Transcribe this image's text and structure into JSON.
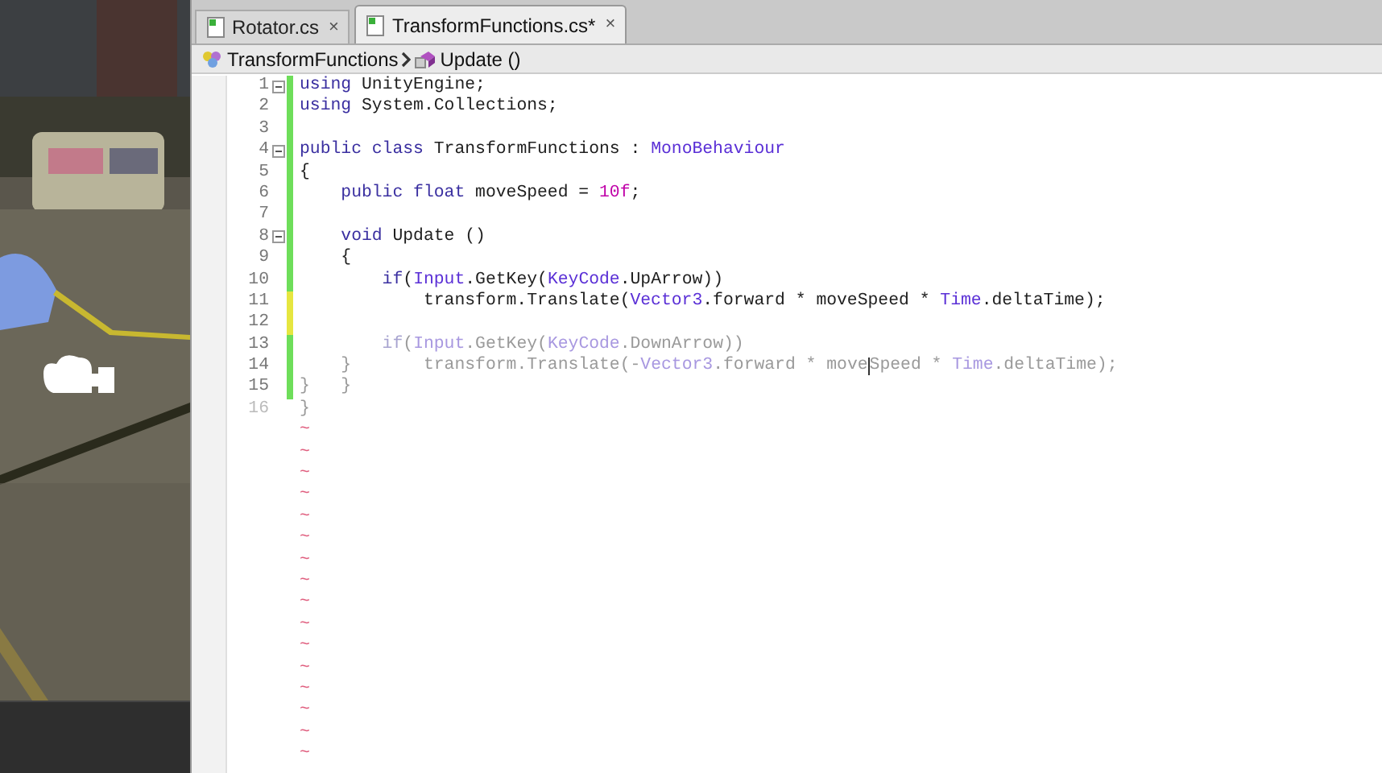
{
  "tabs": [
    {
      "label": "Rotator.cs",
      "close": "×",
      "selected": false
    },
    {
      "label": "TransformFunctions.cs*",
      "close": "×",
      "selected": true
    }
  ],
  "breadcrumb": [
    {
      "kind": "class",
      "label": "TransformFunctions"
    },
    {
      "kind": "method",
      "label": "Update ()"
    }
  ],
  "lines": [
    {
      "number": "1",
      "fold": true,
      "color": "#6ede5a",
      "tokens": [
        {
          "text": "using",
          "kind": "kw"
        },
        {
          "text": " UnityEngine;",
          "kind": "plain"
        }
      ]
    },
    {
      "number": "2",
      "fold": false,
      "color": "#6ede5a",
      "tokens": [
        {
          "text": "using",
          "kind": "kw"
        },
        {
          "text": " System.Collections;",
          "kind": "plain"
        }
      ]
    },
    {
      "number": "3",
      "fold": false,
      "color": "#6ede5a"
    },
    {
      "number": "4",
      "fold": true,
      "color": "#6ede5a",
      "tokens": [
        {
          "text": "public class",
          "kind": "kw"
        },
        {
          "text": " TransformFunctions : ",
          "kind": "plain"
        },
        {
          "text": "MonoBehaviour",
          "kind": "type"
        }
      ]
    },
    {
      "number": "5",
      "fold": false,
      "color": "#6ede5a",
      "tokens": [
        {
          "text": "{",
          "kind": "plain"
        }
      ]
    },
    {
      "number": "6",
      "fold": false,
      "color": "#6ede5a",
      "tokens": [
        {
          "text": "    public float",
          "kind": "kw"
        },
        {
          "text": " moveSpeed = ",
          "kind": "plain"
        },
        {
          "text": "10f",
          "kind": "num"
        },
        {
          "text": ";",
          "kind": "plain"
        }
      ]
    },
    {
      "number": "7",
      "fold": false,
      "color": "#6ede5a"
    },
    {
      "number": "8",
      "fold": true,
      "color": "#6ede5a",
      "tokens": [
        {
          "text": "    void",
          "kind": "kw"
        },
        {
          "text": " Update ()",
          "kind": "plain"
        }
      ]
    },
    {
      "number": "9",
      "fold": false,
      "color": "#6ede5a",
      "tokens": [
        {
          "text": "    {",
          "kind": "plain"
        }
      ]
    },
    {
      "number": "10",
      "fold": false,
      "color": "#6ede5a",
      "tokens": [
        {
          "text": "        if",
          "kind": "kw"
        },
        {
          "text": "(",
          "kind": "plain"
        },
        {
          "text": "Input",
          "kind": "type"
        },
        {
          "text": ".GetKey(",
          "kind": "plain"
        },
        {
          "text": "KeyCode",
          "kind": "type"
        },
        {
          "text": ".UpArrow))",
          "kind": "plain"
        }
      ]
    },
    {
      "number": "11",
      "fold": false,
      "color": "#e6e640",
      "tokens": [
        {
          "text": "            transform.Translate(",
          "kind": "plain"
        },
        {
          "text": "Vector3",
          "kind": "type"
        },
        {
          "text": ".forward * moveSpeed * ",
          "kind": "plain"
        },
        {
          "text": "Time",
          "kind": "type"
        },
        {
          "text": ".deltaTime);",
          "kind": "plain"
        }
      ]
    },
    {
      "number": "12",
      "fold": false,
      "color": "#e6e640"
    },
    {
      "number": "13",
      "fold": false,
      "color": "#6ede5a",
      "tokens": [
        {
          "text": "        if",
          "kind": "kw",
          "dim": true
        },
        {
          "text": "(",
          "kind": "plain",
          "dim": true
        },
        {
          "text": "Input",
          "kind": "type",
          "dim": true
        },
        {
          "text": ".GetKey(",
          "kind": "plain",
          "dim": true
        },
        {
          "text": "KeyCode",
          "kind": "type",
          "dim": true
        },
        {
          "text": ".DownArrow))",
          "kind": "plain",
          "dim": true
        }
      ]
    },
    {
      "number": "14",
      "fold": false,
      "color": "#6ede5a",
      "tokens": [
        {
          "text": "    }",
          "kind": "plain",
          "dim": true
        },
        {
          "text": "       transform.Translate(-",
          "kind": "plain",
          "dim": true
        },
        {
          "text": "Vector3",
          "kind": "type",
          "dim": true
        },
        {
          "text": ".forward * move",
          "kind": "plain",
          "dim": true
        },
        {
          "kind": "caret"
        },
        {
          "text": "Speed * ",
          "kind": "plain",
          "dim": true
        },
        {
          "text": "Time",
          "kind": "type",
          "dim": true
        },
        {
          "text": ".deltaTime);",
          "kind": "plain",
          "dim": true
        }
      ]
    },
    {
      "number": "15",
      "fold": false,
      "color": "#6ede5a",
      "tokens": [
        {
          "text": "}   }",
          "kind": "plain",
          "dim": true
        }
      ]
    },
    {
      "number": "16",
      "fold": false,
      "tokens": [
        {
          "text": "}",
          "kind": "plain",
          "dim": true
        }
      ]
    }
  ],
  "empty_line_marks": [
    "~",
    "~",
    "~",
    "~",
    "~",
    "~",
    "~",
    "~",
    "~",
    "~",
    "~",
    "~",
    "~",
    "~",
    "~",
    "~"
  ]
}
